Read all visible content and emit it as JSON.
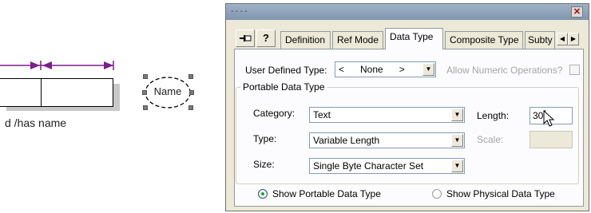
{
  "diagram": {
    "role_text": "d  /has name",
    "ellipse_label": "Name"
  },
  "window": {
    "title": "----",
    "close_icon": "close-icon",
    "toolbar": {
      "pin_icon": "pin-icon",
      "help_icon": "help-icon"
    },
    "tabs": [
      {
        "label": "Definition"
      },
      {
        "label": "Ref Mode"
      },
      {
        "label": "Data Type"
      },
      {
        "label": "Composite Type"
      },
      {
        "label": "Subty"
      }
    ],
    "active_tab": "Data Type",
    "user_defined_type": {
      "label": "User Defined Type:",
      "value": "<      None      >"
    },
    "allow_numeric": {
      "label": "Allow Numeric Operations?",
      "checked": false
    },
    "group_title": "Portable Data Type",
    "category": {
      "label": "Category:",
      "value": "Text"
    },
    "type": {
      "label": "Type:",
      "value": "Variable Length"
    },
    "size": {
      "label": "Size:",
      "value": "Single Byte Character Set"
    },
    "length": {
      "label": "Length:",
      "value": "30"
    },
    "scale": {
      "label": "Scale:",
      "value": ""
    },
    "radio_portable": {
      "label": "Show Portable Data Type",
      "selected": true
    },
    "radio_physical": {
      "label": "Show Physical Data Type",
      "selected": false
    }
  },
  "colors": {
    "arrow": "#7b1f8a",
    "titlebar": "#8fa4bb",
    "panel": "#fcfcfe"
  }
}
